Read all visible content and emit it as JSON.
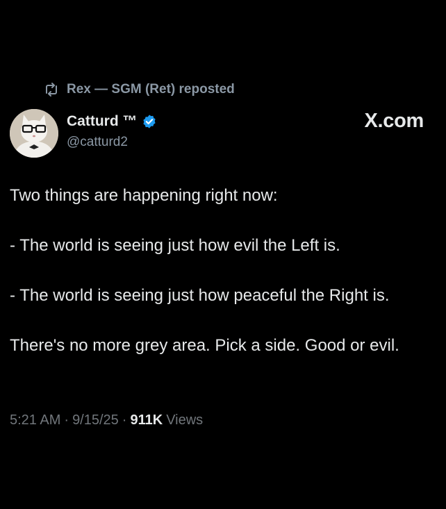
{
  "repost": {
    "icon": "repost-icon",
    "text": "Rex — SGM (Ret) reposted"
  },
  "author": {
    "avatar_icon": "cat-avatar",
    "name": "Catturd ™",
    "verified_icon": "verified-badge-icon",
    "handle": "@catturd2"
  },
  "brand": {
    "label": "X.com"
  },
  "tweet": {
    "line1": "Two things are happening right now:",
    "line2": " - The world is seeing just how evil the Left is.",
    "line3": "- The world is seeing just how peaceful the Right is.",
    "line4": "There's no more grey area.  Pick a side.  Good or evil."
  },
  "meta": {
    "time": "5:21 AM",
    "sep1": "·",
    "date": "9/15/25",
    "sep2": "·",
    "views_count": "911K",
    "views_label": "Views"
  },
  "colors": {
    "background": "#000000",
    "text": "#e7e9ea",
    "muted": "#71767b",
    "verified": "#1d9bf0"
  }
}
